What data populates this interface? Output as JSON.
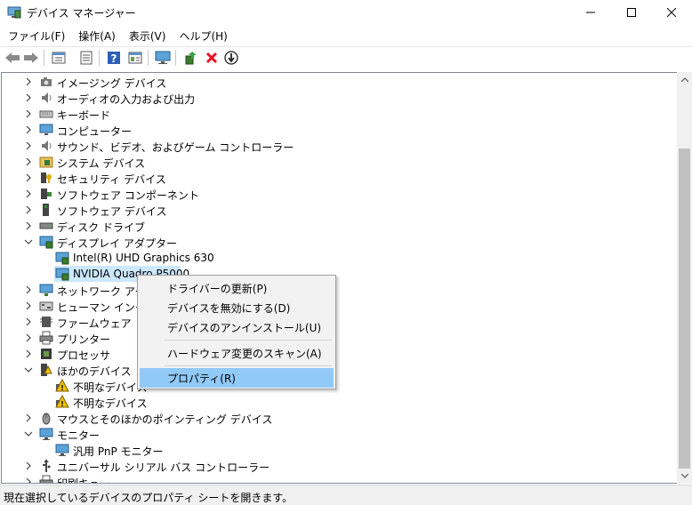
{
  "window": {
    "title": "デバイス マネージャー"
  },
  "menu": [
    "ファイル(F)",
    "操作(A)",
    "表示(V)",
    "ヘルプ(H)"
  ],
  "toolbar": {
    "icons": [
      "back-icon",
      "forward-icon",
      "properties-view-icon",
      "list-view-icon",
      "help-icon",
      "details-icon",
      "monitor-icon",
      "update-driver-icon",
      "uninstall-icon",
      "scan-icon"
    ]
  },
  "tree": [
    {
      "label": "イメージング デバイス",
      "level": 0,
      "expanded": false,
      "icon": "camera-icon"
    },
    {
      "label": "オーディオの入力および出力",
      "level": 0,
      "expanded": false,
      "icon": "speaker-icon"
    },
    {
      "label": "キーボード",
      "level": 0,
      "expanded": false,
      "icon": "keyboard-icon"
    },
    {
      "label": "コンピューター",
      "level": 0,
      "expanded": false,
      "icon": "computer-icon"
    },
    {
      "label": "サウンド、ビデオ、およびゲーム コントローラー",
      "level": 0,
      "expanded": false,
      "icon": "speaker-icon"
    },
    {
      "label": "システム デバイス",
      "level": 0,
      "expanded": false,
      "icon": "folder-chip-icon"
    },
    {
      "label": "セキュリティ デバイス",
      "level": 0,
      "expanded": false,
      "icon": "security-key-icon"
    },
    {
      "label": "ソフトウェア コンポーネント",
      "level": 0,
      "expanded": false,
      "icon": "software-component-icon"
    },
    {
      "label": "ソフトウェア デバイス",
      "level": 0,
      "expanded": false,
      "icon": "software-device-icon"
    },
    {
      "label": "ディスク ドライブ",
      "level": 0,
      "expanded": false,
      "icon": "disk-drive-icon"
    },
    {
      "label": "ディスプレイ アダプター",
      "level": 0,
      "expanded": true,
      "icon": "display-adapter-icon"
    },
    {
      "label": "Intel(R) UHD Graphics 630",
      "level": 1,
      "expanded": null,
      "icon": "display-adapter-icon"
    },
    {
      "label": "NVIDIA Quadro P5000",
      "level": 1,
      "expanded": null,
      "icon": "display-adapter-icon",
      "selected": true
    },
    {
      "label": "ネットワーク アダプター",
      "level": 0,
      "expanded": false,
      "icon": "network-icon"
    },
    {
      "label": "ヒューマン インターフェイス デバイス",
      "level": 0,
      "expanded": false,
      "icon": "hid-icon"
    },
    {
      "label": "ファームウェア",
      "level": 0,
      "expanded": false,
      "icon": "firmware-icon"
    },
    {
      "label": "プリンター",
      "level": 0,
      "expanded": false,
      "icon": "printer-icon"
    },
    {
      "label": "プロセッサ",
      "level": 0,
      "expanded": false,
      "icon": "processor-icon"
    },
    {
      "label": "ほかのデバイス",
      "level": 0,
      "expanded": true,
      "icon": "other-device-icon"
    },
    {
      "label": "不明なデバイス",
      "level": 1,
      "expanded": null,
      "icon": "unknown-device-icon"
    },
    {
      "label": "不明なデバイス",
      "level": 1,
      "expanded": null,
      "icon": "unknown-device-icon"
    },
    {
      "label": "マウスとそのほかのポインティング デバイス",
      "level": 0,
      "expanded": false,
      "icon": "mouse-icon"
    },
    {
      "label": "モニター",
      "level": 0,
      "expanded": true,
      "icon": "monitor-icon"
    },
    {
      "label": "汎用 PnP モニター",
      "level": 1,
      "expanded": null,
      "icon": "monitor-icon"
    },
    {
      "label": "ユニバーサル シリアル バス コントローラー",
      "level": 0,
      "expanded": false,
      "icon": "usb-icon"
    },
    {
      "label": "印刷キュー",
      "level": 0,
      "expanded": false,
      "icon": "printer-icon"
    }
  ],
  "context_menu": {
    "items": [
      {
        "label": "ドライバーの更新(P)"
      },
      {
        "label": "デバイスを無効にする(D)"
      },
      {
        "label": "デバイスのアンインストール(U)"
      },
      {
        "label": "ハードウェア変更のスキャン(A)"
      },
      {
        "label": "プロパティ(R)",
        "highlighted": true
      }
    ]
  },
  "status": "現在選択しているデバイスのプロパティ シートを開きます。",
  "colors": {
    "selection": "#cce8ff",
    "menu_highlight": "#91c9f7",
    "uninstall_red": "#e81123"
  }
}
